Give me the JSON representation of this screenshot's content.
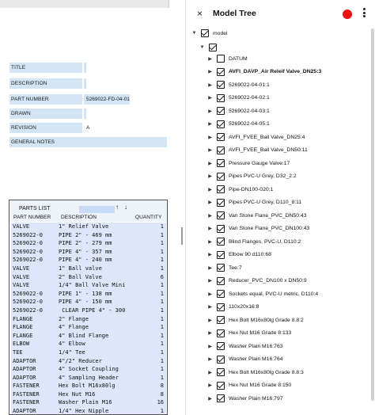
{
  "title_block": {
    "rows": [
      {
        "label": "TITLE",
        "value": ""
      },
      {
        "label": "DESCRIPTION",
        "value": ""
      },
      {
        "label": "PART NUMBER",
        "value": "5269022-FD-04-01"
      },
      {
        "label": "DRAWN",
        "value": ""
      },
      {
        "label": "REVISION",
        "value": "A"
      }
    ],
    "general_notes_label": "GENERAL NOTES"
  },
  "parts_list": {
    "title": "PARTS LIST",
    "sort_up": "↑",
    "sort_down": "↓",
    "headers": {
      "part_number": "PART NUMBER",
      "description": "DESCRIPTION",
      "quantity": "QUANTITY"
    },
    "rows": [
      {
        "part": "VALVE",
        "desc": "1\" Relief Valve",
        "qty": "1"
      },
      {
        "part": "5269022-0",
        "desc": "PIPE 2\" - 469 mm",
        "qty": "1"
      },
      {
        "part": "5269022-0",
        "desc": "PIPE 2\" - 279 mm",
        "qty": "1"
      },
      {
        "part": "5269022-0",
        "desc": "PIPE 4\" - 357 mm",
        "qty": "1"
      },
      {
        "part": "5269022-0",
        "desc": "PIPE 4\" - 240 mm",
        "qty": "1"
      },
      {
        "part": "VALVE",
        "desc": "1\" Ball valve",
        "qty": "1"
      },
      {
        "part": "VALVE",
        "desc": "2\" Ball Valve",
        "qty": "6"
      },
      {
        "part": "VALVE",
        "desc": "1/4\" Ball Valve Mini",
        "qty": "1"
      },
      {
        "part": "5269022-0",
        "desc": "PIPE 1\" - 138 mm",
        "qty": "1"
      },
      {
        "part": "5269022-0",
        "desc": "PIPE 4\" - 150 mm",
        "qty": "1"
      },
      {
        "part": "5269022-0",
        "desc": " CLEAR PIPE 4\" - 300",
        "qty": "1"
      },
      {
        "part": "FLANGE",
        "desc": "2\" Flange",
        "qty": "1"
      },
      {
        "part": "FLANGE",
        "desc": "4\" Flange",
        "qty": "1"
      },
      {
        "part": "FLANGE",
        "desc": "4\" Blind Flange",
        "qty": "1"
      },
      {
        "part": "ELBOW",
        "desc": "4\" Elbow",
        "qty": "1"
      },
      {
        "part": "TEE",
        "desc": "1/4\" Tee",
        "qty": "1"
      },
      {
        "part": "ADAPTOR",
        "desc": "4\"/2\" Reducer",
        "qty": "1"
      },
      {
        "part": "ADAPTOR",
        "desc": "4\" Socket Coupling",
        "qty": "1"
      },
      {
        "part": "ADAPTOR",
        "desc": "4\" Sampling Header",
        "qty": "1"
      },
      {
        "part": "FASTENER",
        "desc": "Hex Bolt M16x80lg",
        "qty": "8"
      },
      {
        "part": "FASTENER",
        "desc": "Hex Nut M16",
        "qty": "8"
      },
      {
        "part": "FASTENER",
        "desc": "Washer Plain M16",
        "qty": "16"
      },
      {
        "part": "ADAPTOR",
        "desc": "1/4\" Hex Nipple",
        "qty": "1"
      }
    ]
  },
  "model_tree": {
    "title": "Model Tree",
    "close_icon": "×",
    "root_label": "model",
    "level1_label": "",
    "items": [
      {
        "label": "DATUM",
        "checked": false,
        "bold": false
      },
      {
        "label": "AVFI_DAVP_Air Releif Valve_DN25:3",
        "checked": true,
        "bold": true
      },
      {
        "label": "5269022-04-01:1",
        "checked": true,
        "bold": false
      },
      {
        "label": "5269022-04-02:1",
        "checked": true,
        "bold": false
      },
      {
        "label": "5269022-04-03:1",
        "checked": true,
        "bold": false
      },
      {
        "label": "5269022-04-05:1",
        "checked": true,
        "bold": false
      },
      {
        "label": "AVFI_FVEE_Ball Valve_DN25:4",
        "checked": true,
        "bold": false
      },
      {
        "label": "AVFI_FVEE_Ball Valve_DN50:11",
        "checked": true,
        "bold": false
      },
      {
        "label": "Pressure Gauge Valve:17",
        "checked": true,
        "bold": false
      },
      {
        "label": "Pipes PVC-U Grey, D32_2:2",
        "checked": true,
        "bold": false
      },
      {
        "label": "Pipe-DN100-020:1",
        "checked": true,
        "bold": false
      },
      {
        "label": "Pipes PVC-U Grey, D110_8:11",
        "checked": true,
        "bold": false
      },
      {
        "label": "Van Stone Flane_PVC_DN50:43",
        "checked": true,
        "bold": false
      },
      {
        "label": "Van Stone Flane_PVC_DN100:43",
        "checked": true,
        "bold": false
      },
      {
        "label": "Blind Flanges, PVC-U, D110:2",
        "checked": true,
        "bold": false
      },
      {
        "label": "Elbow 90 d110:68",
        "checked": true,
        "bold": false
      },
      {
        "label": "Tee:7",
        "checked": true,
        "bold": false
      },
      {
        "label": "Reducer_PVC_DN100 x DN50:9",
        "checked": true,
        "bold": false
      },
      {
        "label": "Sockets equal, PVC-U metric, D110:4",
        "checked": true,
        "bold": false
      },
      {
        "label": "110x20x16:8",
        "checked": true,
        "bold": false
      },
      {
        "label": "Hex Bolt M16x80lg Grade 8.8:2",
        "checked": true,
        "bold": false
      },
      {
        "label": "Hex Nut M16 Grade 8:133",
        "checked": true,
        "bold": false
      },
      {
        "label": "Washer Plain M16:763",
        "checked": true,
        "bold": false
      },
      {
        "label": "Washer Plain M16:764",
        "checked": true,
        "bold": false
      },
      {
        "label": "Hex Bolt M16x80lg Grade 8.8:3",
        "checked": true,
        "bold": false
      },
      {
        "label": "Hex Nut M16 Grade 8:150",
        "checked": true,
        "bold": false
      },
      {
        "label": "Washer Plain M16:797",
        "checked": true,
        "bold": false
      }
    ],
    "record_color": "#ee1111"
  }
}
